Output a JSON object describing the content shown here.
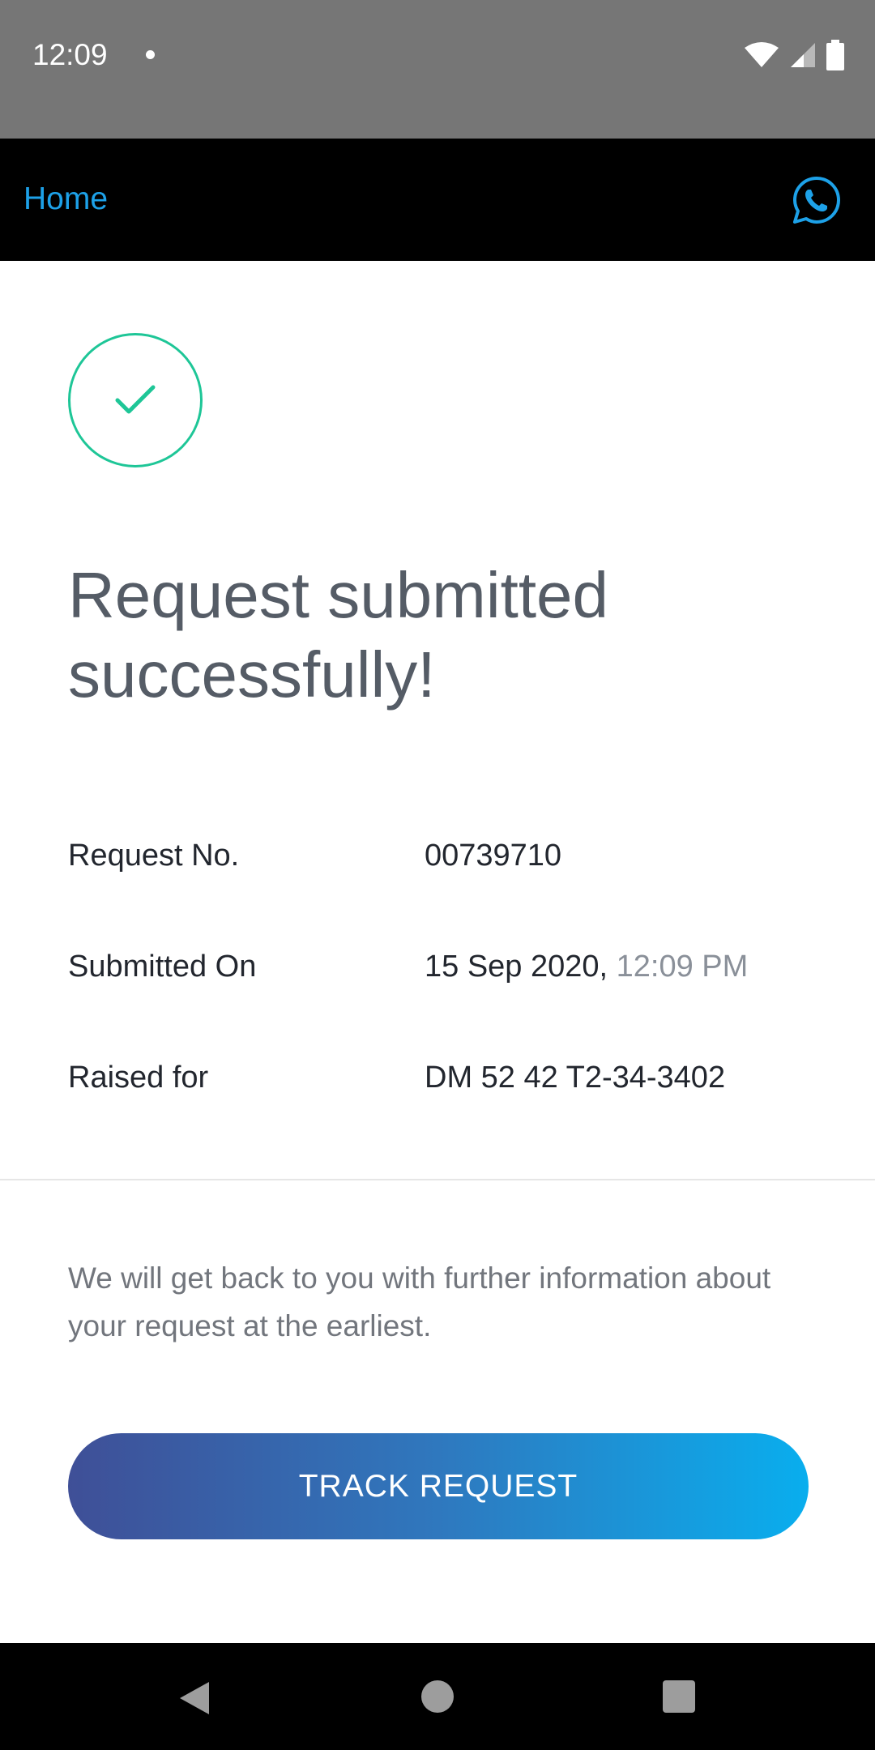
{
  "status_bar": {
    "time": "12:09"
  },
  "app_bar": {
    "home_label": "Home",
    "chat_icon": "whatsapp-icon",
    "accent_color": "#1da1e8"
  },
  "success": {
    "icon": "check-circle-icon",
    "color": "#1ec697",
    "headline": "Request submitted successfully!"
  },
  "details": [
    {
      "label": "Request No.",
      "value": "00739710",
      "time": ""
    },
    {
      "label": "Submitted On",
      "value": "15 Sep 2020, ",
      "time": "12:09 PM"
    },
    {
      "label": "Raised for",
      "value": "DM 52 42 T2-34-3402",
      "time": ""
    }
  ],
  "info_text": "We will get back to you with further information about your request at the earliest.",
  "track_button": {
    "label": "TRACK REQUEST",
    "gradient": [
      "#3f4f97",
      "#09aeee"
    ]
  },
  "nav_bar": {
    "icons": [
      "back-icon",
      "home-icon",
      "recents-icon"
    ]
  }
}
